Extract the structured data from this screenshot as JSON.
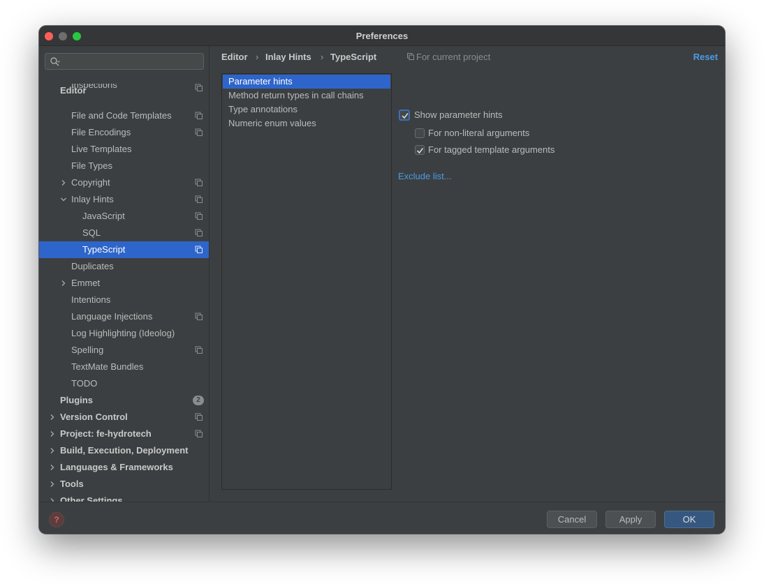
{
  "window": {
    "title": "Preferences"
  },
  "sidebar": {
    "search": {
      "value": "",
      "placeholder": ""
    },
    "items": [
      {
        "label": "Editor",
        "level": 0,
        "bold": true
      },
      {
        "label": "Inspections",
        "level": 1,
        "project_icon": true
      },
      {
        "label": "File and Code Templates",
        "level": 1,
        "project_icon": true
      },
      {
        "label": "File Encodings",
        "level": 1,
        "project_icon": true
      },
      {
        "label": "Live Templates",
        "level": 1
      },
      {
        "label": "File Types",
        "level": 1
      },
      {
        "label": "Copyright",
        "level": 1,
        "expander": "collapsed",
        "project_icon": true
      },
      {
        "label": "Inlay Hints",
        "level": 1,
        "expander": "expanded",
        "project_icon": true
      },
      {
        "label": "JavaScript",
        "level": 2,
        "project_icon": true
      },
      {
        "label": "SQL",
        "level": 2,
        "project_icon": true
      },
      {
        "label": "TypeScript",
        "level": 2,
        "project_icon": true,
        "selected": true
      },
      {
        "label": "Duplicates",
        "level": 1
      },
      {
        "label": "Emmet",
        "level": 1,
        "expander": "collapsed"
      },
      {
        "label": "Intentions",
        "level": 1
      },
      {
        "label": "Language Injections",
        "level": 1,
        "project_icon": true
      },
      {
        "label": "Log Highlighting (Ideolog)",
        "level": 1
      },
      {
        "label": "Spelling",
        "level": 1,
        "project_icon": true
      },
      {
        "label": "TextMate Bundles",
        "level": 1
      },
      {
        "label": "TODO",
        "level": 1
      },
      {
        "label": "Plugins",
        "level": 0,
        "bold": true,
        "badge": "2"
      },
      {
        "label": "Version Control",
        "level": 0,
        "bold": true,
        "expander": "collapsed",
        "project_icon": true
      },
      {
        "label": "Project: fe-hydrotech",
        "level": 0,
        "bold": true,
        "expander": "collapsed",
        "project_icon": true
      },
      {
        "label": "Build, Execution, Deployment",
        "level": 0,
        "bold": true,
        "expander": "collapsed"
      },
      {
        "label": "Languages & Frameworks",
        "level": 0,
        "bold": true,
        "expander": "collapsed"
      },
      {
        "label": "Tools",
        "level": 0,
        "bold": true,
        "expander": "collapsed"
      },
      {
        "label": "Other Settings",
        "level": 0,
        "bold": true,
        "expander": "collapsed"
      }
    ]
  },
  "breadcrumb": [
    "Editor",
    "Inlay Hints",
    "TypeScript"
  ],
  "for_current_project": "For current project",
  "reset_label": "Reset",
  "hint_types": [
    {
      "label": "Parameter hints",
      "selected": true
    },
    {
      "label": "Method return types in call chains"
    },
    {
      "label": "Type annotations"
    },
    {
      "label": "Numeric enum values"
    }
  ],
  "options": {
    "show_parameter_hints": {
      "label": "Show parameter hints",
      "checked": true
    },
    "non_literal": {
      "label": "For non-literal arguments",
      "checked": false
    },
    "tagged_template": {
      "label": "For tagged template arguments",
      "checked": true
    }
  },
  "exclude_list_label": "Exclude list...",
  "footer": {
    "help_glyph": "?",
    "cancel": "Cancel",
    "apply": "Apply",
    "ok": "OK"
  },
  "colors": {
    "accent": "#2e65ca",
    "link": "#4a9ce8",
    "background": "#3c3f41"
  }
}
